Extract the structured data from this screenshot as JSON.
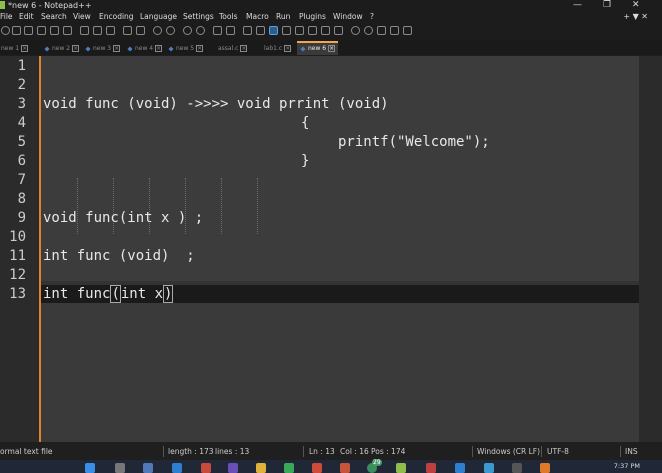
{
  "window": {
    "title": "*new 6 - Notepad++"
  },
  "menu": [
    "File",
    "Edit",
    "Search",
    "View",
    "Encoding",
    "Language",
    "Settings",
    "Tools",
    "Macro",
    "Run",
    "Plugins",
    "Window",
    "?"
  ],
  "menu_right": "+ ▼ ✕",
  "tabs": [
    {
      "label": "new 1",
      "active": false
    },
    {
      "label": "new 2",
      "active": false
    },
    {
      "label": "new 3",
      "active": false
    },
    {
      "label": "new 4",
      "active": false
    },
    {
      "label": "new 5",
      "active": false
    },
    {
      "label": "assal.c",
      "active": false
    },
    {
      "label": "lab1.c",
      "active": false
    },
    {
      "label": "new 6",
      "active": true
    }
  ],
  "lines": [
    "1",
    "2",
    "3",
    "4",
    "5",
    "6",
    "7",
    "8",
    "9",
    "10",
    "11",
    "12",
    "13"
  ],
  "code": {
    "l3a": "void func (void) ->>>> void prrint (void)",
    "l4": "{",
    "l5": "printf(\"Welcome\");",
    "l6": "}",
    "l9": "void func(int x ) ;",
    "l11": "int func (void)  ;",
    "l13a": "int func",
    "l13b": "(",
    "l13c": "int x",
    "l13d": ")"
  },
  "status": {
    "filetype": "ormal text file",
    "length": "length : 173",
    "lines": "lines : 13",
    "ln": "Ln : 13",
    "col": "Col : 16",
    "pos": "Pos : 174",
    "eol": "Windows (CR LF)",
    "encoding": "UTF-8",
    "mode": "INS"
  },
  "taskbar": {
    "time": "7:37 PM",
    "badge": "29"
  },
  "colors": {
    "accent": "#e0832d",
    "active_tab_border": "#f2a74b"
  }
}
